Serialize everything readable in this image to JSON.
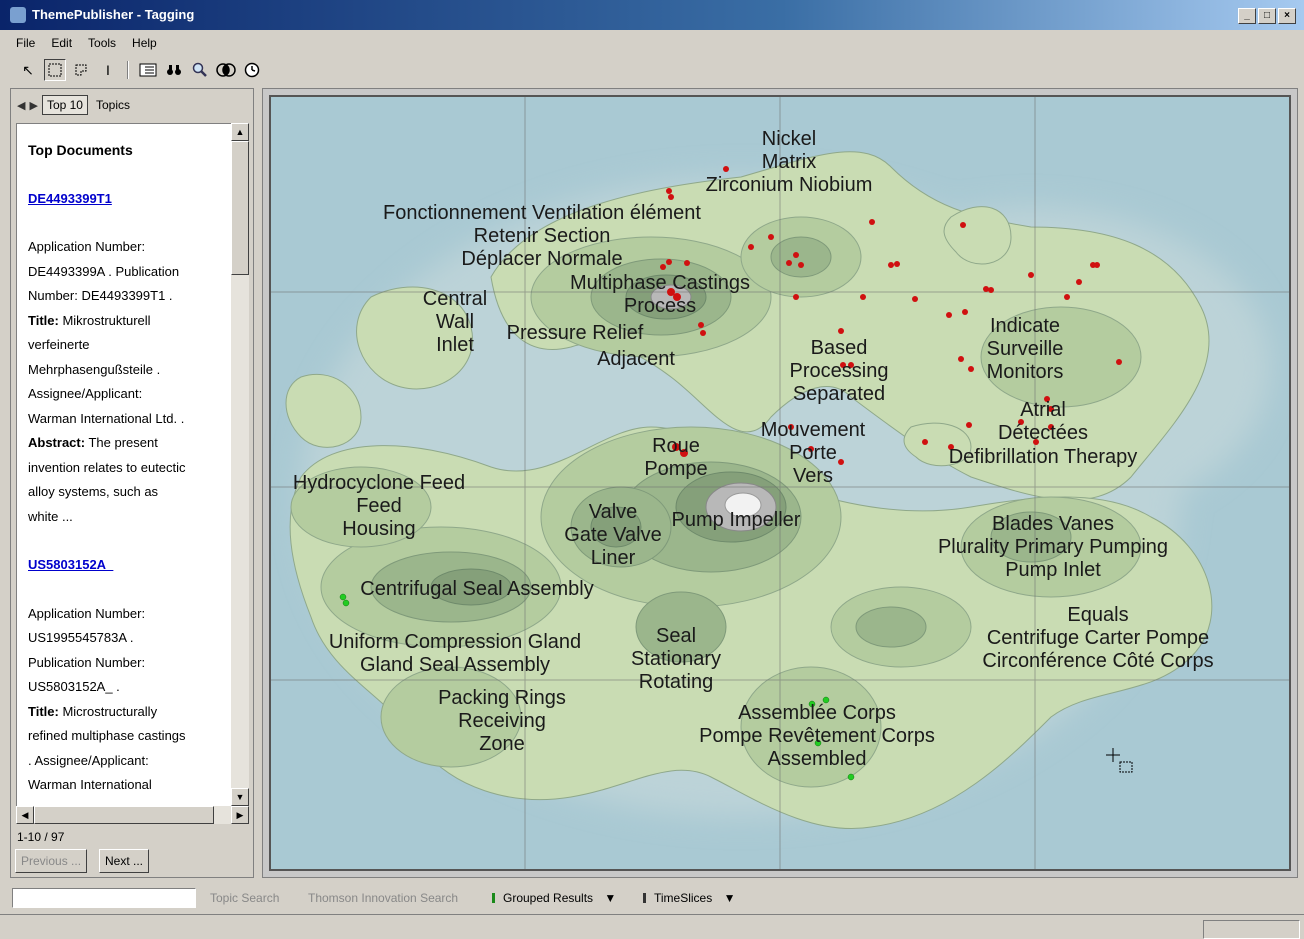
{
  "window": {
    "title": "ThemePublisher - Tagging",
    "buttons": [
      "_",
      "□",
      "×"
    ]
  },
  "menu": [
    "File",
    "Edit",
    "Tools",
    "Help"
  ],
  "toolbar": {
    "icons": [
      "pointer-icon",
      "rect-select-icon",
      "lasso-icon",
      "text-cursor-icon",
      "list-icon",
      "binoculars-icon",
      "magnifier-icon",
      "overlap-icon",
      "clock-icon"
    ]
  },
  "left_panel": {
    "tab_active": "Top 10",
    "tab_other": "Topics",
    "heading": "Top Documents",
    "documents": [
      {
        "link": "DE4493399T1",
        "app_label": "Application Number:",
        "app_value": "DE4493399A . Publication",
        "pub_value": "Number: DE4493399T1 .",
        "title_label": "Title:",
        "title_text": " Mikrostrukturell",
        "title_cont1": "verfeinerte",
        "title_cont2": "Mehrphasengußsteile .",
        "assignee_label": "Assignee/Applicant:",
        "assignee_value": "Warman International Ltd. .",
        "abstract_label": "Abstract:",
        "abstract_text": " The present",
        "abstract_cont1": "invention relates to eutectic",
        "abstract_cont2": "alloy systems, such as",
        "abstract_cont3": "white ..."
      },
      {
        "link": "US5803152A_",
        "app_label": "Application Number:",
        "app_value": "US1995545783A .",
        "pub_label": "Publication Number:",
        "pub_value": "US5803152A_ .",
        "title_label": "Title:",
        "title_text": " Microstructurally",
        "title_cont1": "refined multiphase castings",
        "title_cont2": ". Assignee/Applicant:",
        "assignee_value": "Warman International"
      }
    ],
    "pager": "1-10 / 97",
    "prev_label": "Previous ...",
    "next_label": "Next ..."
  },
  "map": {
    "labels": [
      {
        "text": "Nickel"
      },
      {
        "text": "Matrix"
      },
      {
        "text": "Zirconium Niobium"
      },
      {
        "text": "Fonctionnement Ventilation élément"
      },
      {
        "text": "Retenir Section"
      },
      {
        "text": "Déplacer Normale"
      },
      {
        "text": "Multiphase Castings"
      },
      {
        "text": "Process"
      },
      {
        "text": "Central"
      },
      {
        "text": "Wall"
      },
      {
        "text": "Inlet"
      },
      {
        "text": "Pressure Relief"
      },
      {
        "text": "Adjacent"
      },
      {
        "text": "Based"
      },
      {
        "text": "Processing"
      },
      {
        "text": "Separated"
      },
      {
        "text": "Indicate"
      },
      {
        "text": "Surveille"
      },
      {
        "text": "Monitors"
      },
      {
        "text": "Atrial"
      },
      {
        "text": "Détectées"
      },
      {
        "text": "Defibrillation Therapy"
      },
      {
        "text": "Mouvement"
      },
      {
        "text": "Porte"
      },
      {
        "text": "Vers"
      },
      {
        "text": "Roue"
      },
      {
        "text": "Pompe"
      },
      {
        "text": "Hydrocyclone Feed"
      },
      {
        "text": "Feed"
      },
      {
        "text": "Housing"
      },
      {
        "text": "Valve"
      },
      {
        "text": "Gate Valve"
      },
      {
        "text": "Liner"
      },
      {
        "text": "Pump Impeller"
      },
      {
        "text": "Blades Vanes"
      },
      {
        "text": "Plurality Primary Pumping"
      },
      {
        "text": "Pump Inlet"
      },
      {
        "text": "Centrifugal Seal Assembly"
      },
      {
        "text": "Uniform Compression Gland"
      },
      {
        "text": "Gland Seal Assembly"
      },
      {
        "text": "Seal"
      },
      {
        "text": "Stationary"
      },
      {
        "text": "Rotating"
      },
      {
        "text": "Equals"
      },
      {
        "text": "Centrifuge Carter Pompe"
      },
      {
        "text": "Circonférence Côté Corps"
      },
      {
        "text": "Packing Rings"
      },
      {
        "text": "Receiving"
      },
      {
        "text": "Zone"
      },
      {
        "text": "Assemblée Corps"
      },
      {
        "text": "Pompe Revêtement Corps"
      },
      {
        "text": "Assembled"
      }
    ],
    "colors": {
      "water": "#a9c9d3",
      "land": "#c9dcb3",
      "hill": "#9bb68c",
      "peak": "#f2f2f2",
      "red_point": "#d01010",
      "green_point": "#22cc22"
    }
  },
  "statusbar": {
    "topic_search": "Topic Search",
    "thomson_search": "Thomson Innovation Search",
    "grouped_results": "Grouped Results",
    "timeslices": "TimeSlices"
  }
}
